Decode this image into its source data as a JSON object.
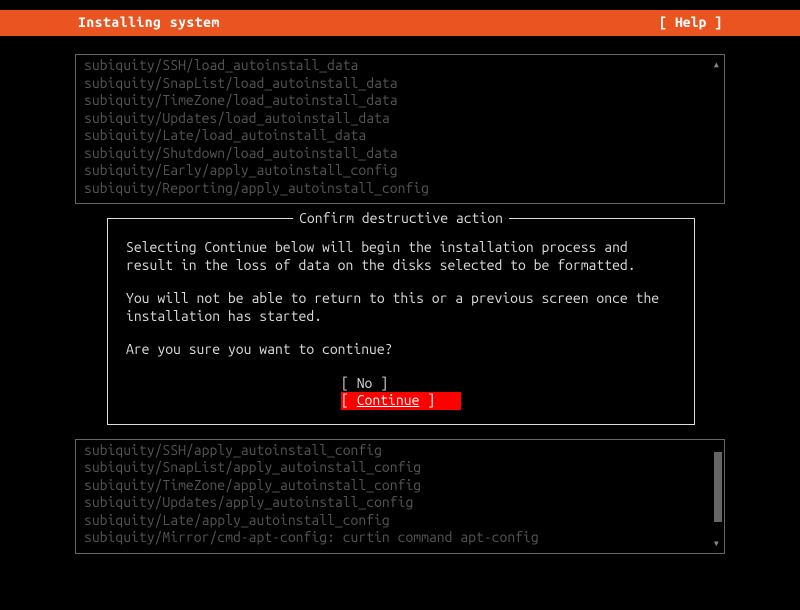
{
  "header": {
    "title": "Installing system",
    "help": "[ Help ]"
  },
  "log_top": [
    "subiquity/SSH/load_autoinstall_data",
    "subiquity/SnapList/load_autoinstall_data",
    "subiquity/TimeZone/load_autoinstall_data",
    "subiquity/Updates/load_autoinstall_data",
    "subiquity/Late/load_autoinstall_data",
    "subiquity/Shutdown/load_autoinstall_data",
    "subiquity/Early/apply_autoinstall_config",
    "subiquity/Reporting/apply_autoinstall_config"
  ],
  "dialog": {
    "title": " Confirm destructive action ",
    "p1": "Selecting Continue below will begin the installation process and result in the loss of data on the disks selected to be formatted.",
    "p2": "You will not be able to return to this or a previous screen once the installation has started.",
    "p3": "Are you sure you want to continue?",
    "no_label": "No",
    "continue_label": "Continue"
  },
  "log_bottom": [
    "subiquity/SSH/apply_autoinstall_config",
    "subiquity/SnapList/apply_autoinstall_config",
    "subiquity/TimeZone/apply_autoinstall_config",
    "subiquity/Updates/apply_autoinstall_config",
    "subiquity/Late/apply_autoinstall_config",
    "subiquity/Mirror/cmd-apt-config: curtin command apt-config"
  ],
  "arrows": {
    "up": "▴",
    "down": "▾"
  }
}
